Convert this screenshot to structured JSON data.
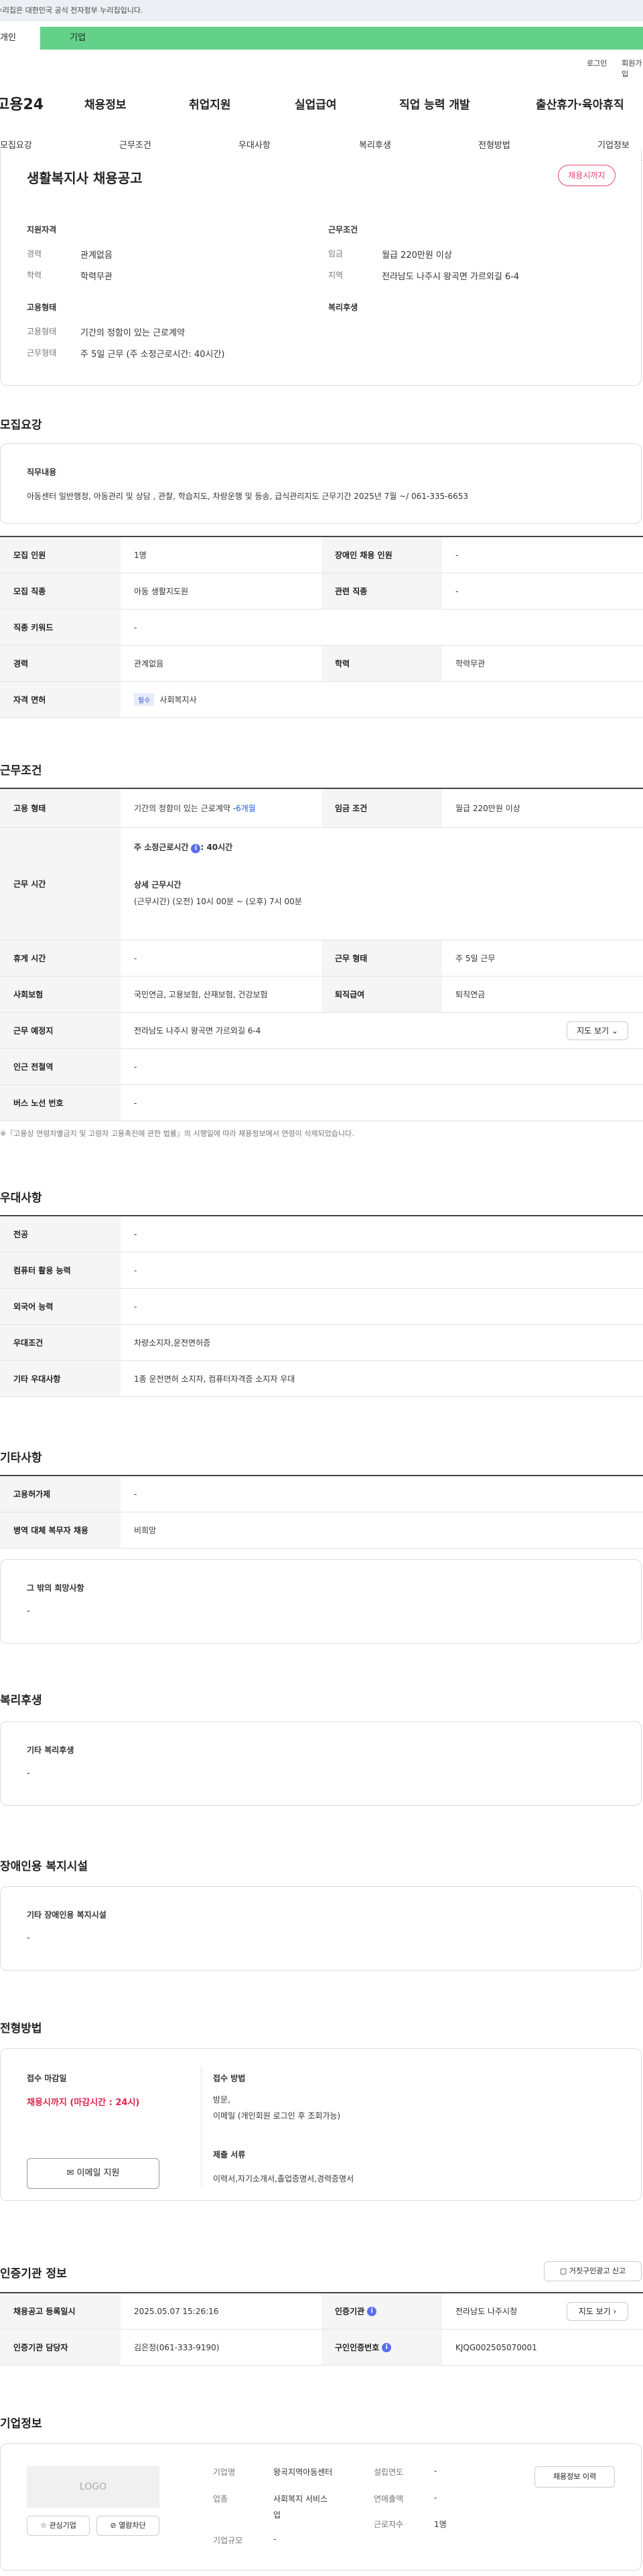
{
  "top": {
    "notice": "이 누리집은 대한민국 공식 전자정부 누리집입니다.",
    "user_tab": "개인",
    "company_tab": "기업",
    "login": "로그인",
    "join": "회원가입"
  },
  "gnb": {
    "logo": "고용24",
    "menu": [
      "채용정보",
      "취업지원",
      "실업급여",
      "직업 능력 개발",
      "출산휴가·육아휴직"
    ]
  },
  "tabs": [
    "모집요강",
    "근무조건",
    "우대사항",
    "복리후생",
    "전형방법",
    "기업정보"
  ],
  "title": "생활복지사 채용공고",
  "badge": "채용시까지",
  "summary": {
    "qual_h": "지원자격",
    "career_l": "경력",
    "career_v": "관계없음",
    "edu_l": "학력",
    "edu_v": "학력무관",
    "cond_h": "근무조건",
    "pay_l": "임금",
    "pay_v": "월급 220만원 이상",
    "area_l": "지역",
    "area_v": "전라남도 나주시 왕곡면 가르외길 6-4",
    "emp_h": "고용형태",
    "emp_l": "고용형태",
    "emp_v": "기간의 정함이 있는 근로계약",
    "work_l": "근무형태",
    "work_v": "주 5일 근무 (주 소정근로시간: 40시간)",
    "welfare_h": "복리후생"
  },
  "recruit": {
    "h": "모집요강",
    "job_h": "직무내용",
    "job_v": "아동센터 일반행정, 아동관리 및 상담 , 관찰, 학습지도, 차량운행 및 등송, 급식관리지도 근무기간 2025년 7월 ~/ 061-335-6653",
    "r1_l": "모집 인원",
    "r1_v": "1명",
    "r1b_l": "장애인 채용 인원",
    "r1b_v": "-",
    "r2_l": "모집 직종",
    "r2_v": "아동 생활지도원",
    "r2b_l": "관련 직종",
    "r2b_v": "-",
    "r3_l": "직종 키워드",
    "r3_v": "-",
    "r4_l": "경력",
    "r4_v": "관계없음",
    "r4b_l": "학력",
    "r4b_v": "학력무관",
    "r5_l": "자격 면허",
    "r5_tag": "필수",
    "r5_v": "사회복지사"
  },
  "work": {
    "h": "근무조건",
    "w1_l": "고용 형태",
    "w1_v": "기간의 정함이 있는 근로계약 - ",
    "w1_link": "6개월",
    "w1b_l": "임금 조건",
    "w1b_v": "월급 220만원 이상",
    "w2_l": "근무 시간",
    "w2_a": "주 소정근로시간",
    "w2_b": ": 40시간",
    "w2_c": "상세 근무시간",
    "w2_d": "(근무시간) (오전) 10시 00분 ~ (오후) 7시 00분",
    "w3_l": "휴게 시간",
    "w3_v": "-",
    "w3b_l": "근무 형태",
    "w3b_v": "주 5일 근무",
    "w4_l": "사회보험",
    "w4_v": "국민연금, 고용보험, 산재보험, 건강보험",
    "w4b_l": "퇴직급여",
    "w4b_v": "퇴직연금",
    "w5_l": "근무 예정지",
    "w5_v": "전라남도 나주시 왕곡면 가르외길 6-4",
    "w5_btn": "지도 보기",
    "w6_l": "인근 전철역",
    "w6_v": "-",
    "w7_l": "버스 노선 번호",
    "w7_v": "-",
    "note": "※『고용상 연령차별금지 및 고령자 고용촉진에 관한 법률』의 시행일에 따라 채용정보에서 연령이 삭제되었습니다."
  },
  "pref": {
    "h": "우대사항",
    "p1_l": "전공",
    "p1_v": "-",
    "p2_l": "컴퓨터 활용 능력",
    "p2_v": "-",
    "p3_l": "외국어 능력",
    "p3_v": "-",
    "p4_l": "우대조건",
    "p4_v": "차량소지자,운전면허증",
    "p5_l": "기타 우대사항",
    "p5_v": "1종 운전면허 소지자, 컴퓨터자격증 소지자 우대"
  },
  "etc": {
    "h": "기타사항",
    "e1_l": "고용허가제",
    "e1_v": "-",
    "e2_l": "병역 대체 복무자 채용",
    "e2_v": "비희망",
    "e3_h": "그 밖의 희망사항",
    "e3_v": "-"
  },
  "welfare": {
    "h": "복리후생",
    "b_h": "기타 복리후생",
    "b_v": "-"
  },
  "disab": {
    "h": "장애인용 복지시설",
    "b_h": "기타 장애인용 복지시설",
    "b_v": "-"
  },
  "sel": {
    "h": "전형방법",
    "deadline_h": "접수 마감일",
    "deadline_v": "채용시까지 (마감시간 : 24시)",
    "method_h": "접수 방법",
    "method_v1": "방문,",
    "method_v2": "이메일 (개인회원 로그인 후 조회가능)",
    "doc_h": "제출 서류",
    "doc_v": "이력서,자기소개서,졸업증명서,경력증명서",
    "apply_btn": "이메일 지원"
  },
  "cert": {
    "h": "인증기관 정보",
    "report_btn": "거짓구인광고 신고",
    "c1_l": "채용공고 등록일시",
    "c1_v": "2025.05.07 15:26:16",
    "c1b_l": "인증기관",
    "c1b_v": "전라남도 나주시청",
    "c1b_btn": "지도 보기",
    "c2_l": "인증기관 담당자",
    "c2_v": "김은정(061-333-9190)",
    "c2b_l": "구인인증번호",
    "c2b_v": "KJQG002505070001"
  },
  "company": {
    "h": "기업정보",
    "logo": "LOGO",
    "fav_btn": "관심기업",
    "block_btn": "열람차단",
    "n_l": "기업명",
    "n_v": "왕곡지역아동센터",
    "ind_l": "업종",
    "ind_v1": "사회복지 서비스",
    "ind_v2": "업",
    "size_l": "기업규모",
    "size_v": "-",
    "est_l": "설립연도",
    "est_v": "-",
    "emp_l": "근로자수",
    "emp_v": "1명",
    "sales_l": "연매출액",
    "sales_v": "-",
    "history_btn": "채용정보 이력"
  }
}
